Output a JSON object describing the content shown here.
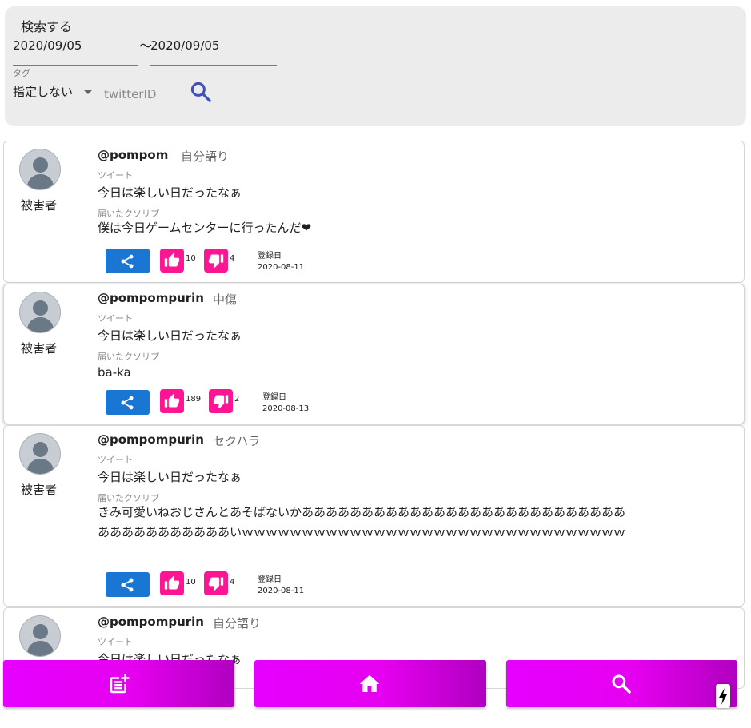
{
  "search": {
    "title": "検索する",
    "date_from": "2020/09/05",
    "tilde": "〜",
    "date_to": "2020/09/05",
    "tag_label": "タグ",
    "tag_value": "指定しない",
    "twitter_placeholder": "twitterID"
  },
  "labels": {
    "role": "被害者",
    "tweet": "ツイート",
    "reply": "届いたクソリプ",
    "registered": "登録日"
  },
  "posts": [
    {
      "handle": "@pompom",
      "category": "自分語り",
      "tweet": "今日は楽しい日だったなぁ",
      "reply": "僕は今日ゲームセンターに行ったんだ❤",
      "likes": "10",
      "dislikes": "4",
      "date": "2020-08-11"
    },
    {
      "handle": "@pompompurin",
      "category": "中傷",
      "tweet": "今日は楽しい日だったなぁ",
      "reply": "ba-ka",
      "likes": "189",
      "dislikes": "2",
      "date": "2020-08-13"
    },
    {
      "handle": "@pompompurin",
      "category": "セクハラ",
      "tweet": "今日は楽しい日だったなぁ",
      "reply": "きみ可愛いねおじさんとあそばないかああああああああああああああああああああああああああああああああああああああいｗｗｗｗｗｗｗｗｗｗｗｗｗｗｗｗｗｗｗｗｗｗｗｗｗｗｗｗｗｗｗｗ",
      "likes": "10",
      "dislikes": "4",
      "date": "2020-08-11"
    },
    {
      "handle": "@pompompurin",
      "category": "自分語り",
      "tweet": "今日は楽しい日だったなぁ"
    }
  ],
  "icons": {
    "search": "search-icon",
    "share": "share-icon",
    "like": "thumb-up-icon",
    "dislike": "thumb-down-icon",
    "post": "post-add-icon",
    "home": "home-icon",
    "bolt": "bolt-icon"
  },
  "colors": {
    "share": "#1976d2",
    "reaction": "#ff1493",
    "nav": "#e600ff",
    "search_icon": "#3f51b5"
  }
}
